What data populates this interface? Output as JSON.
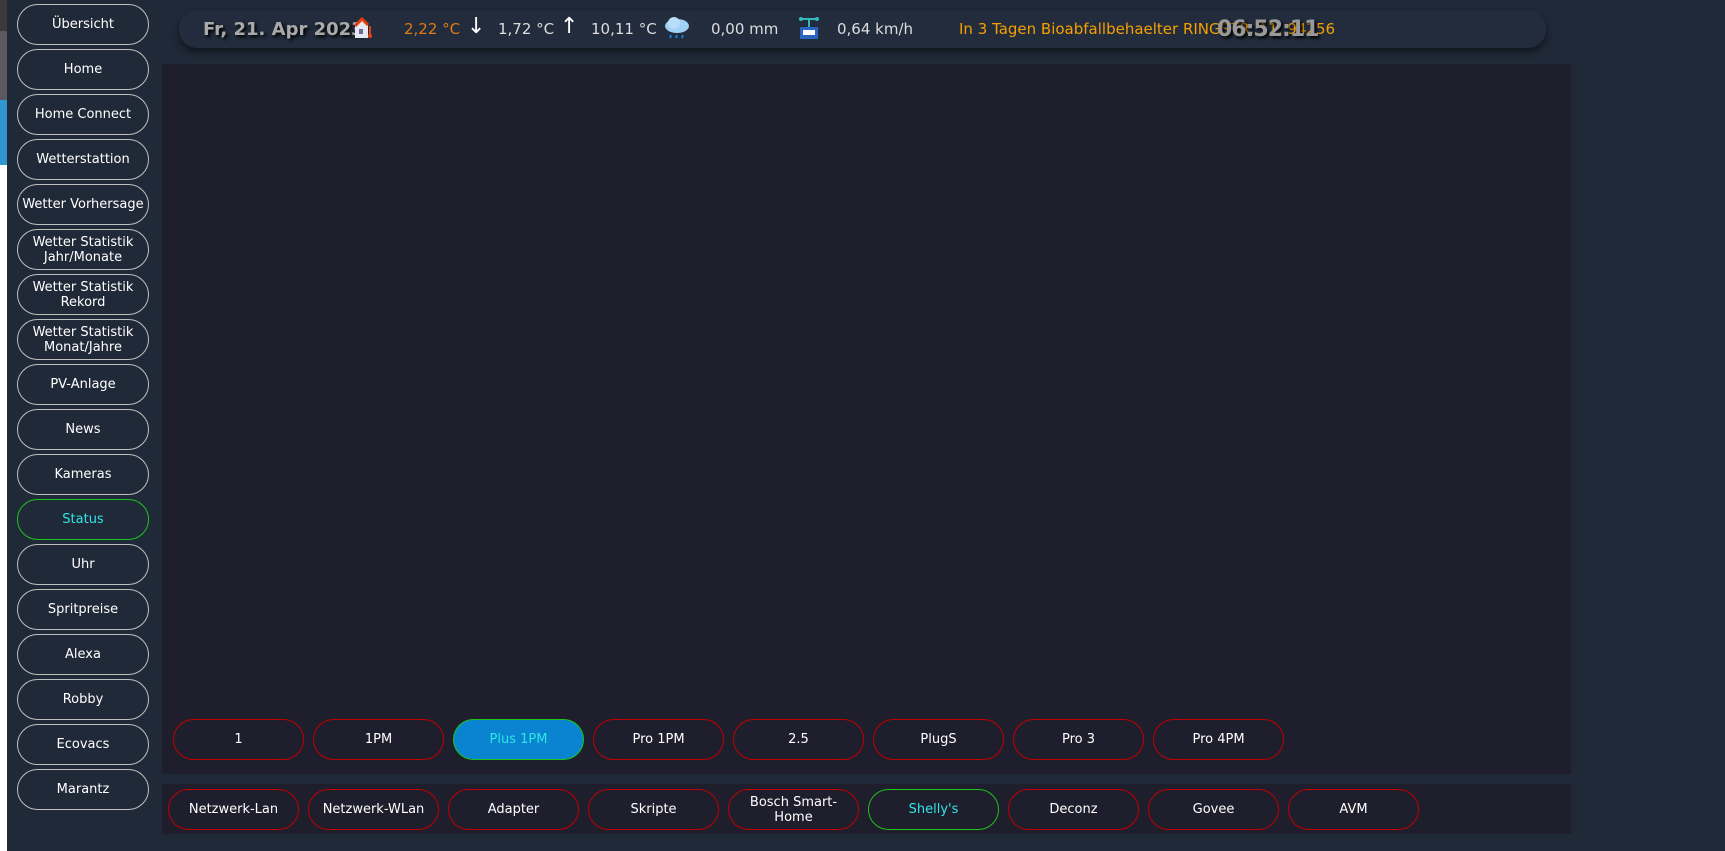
{
  "sidebar": {
    "items": [
      "Übersicht",
      "Home",
      "Home Connect",
      "Wetterstattion",
      "Wetter Vorhersage",
      "Wetter Statistik Jahr/Monate",
      "Wetter Statistik Rekord",
      "Wetter Statistik Monat/Jahre",
      "PV-Anlage",
      "News",
      "Kameras",
      "Status",
      "Uhr",
      "Spritpreise",
      "Alexa",
      "Robby",
      "Ecovacs",
      "Marantz"
    ],
    "active": "Status"
  },
  "header": {
    "date": "Fr, 21. Apr 2023",
    "temp_current": "2,22 °C",
    "temp_min": "1,72 °C",
    "temp_max": "10,11 °C",
    "rain": "0,00 mm",
    "wind": "0,64 km/h",
    "notice": "In 3 Tagen Bioabfallbehaelter RINGSTR. 11, 94256",
    "clock": "06:52:11"
  },
  "shelly_tabs": {
    "items": [
      "1",
      "1PM",
      "Plus 1PM",
      "Pro 1PM",
      "2.5",
      "PlugS",
      "Pro 3",
      "Pro 4PM"
    ],
    "selected": "Plus 1PM"
  },
  "status_tabs": {
    "items": [
      "Netzwerk-Lan",
      "Netzwerk-WLan",
      "Adapter",
      "Skripte",
      "Bosch Smart-Home",
      "Shelly's",
      "Deconz",
      "Govee",
      "AVM"
    ],
    "active": "Shelly's"
  },
  "colors": {
    "accent_orange": "#f5a000",
    "temp_orange": "#e07b12",
    "active_green": "#1cc41c",
    "active_text": "#2fe6e6",
    "inactive_border": "#c00000",
    "selected_bg": "#0a84d0"
  }
}
